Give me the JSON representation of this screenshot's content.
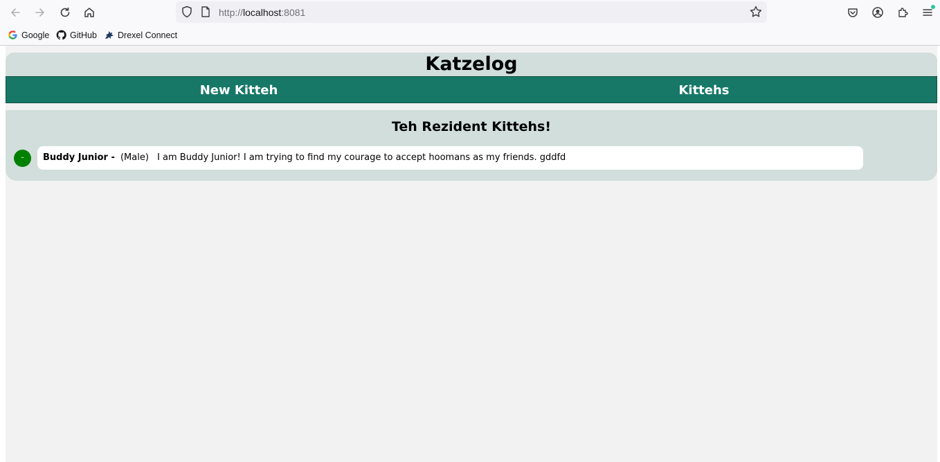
{
  "browser": {
    "url_prefix": "http://",
    "url_host": "localhost",
    "url_port": ":8081",
    "bookmarks": [
      {
        "label": "Google",
        "icon": "google-icon"
      },
      {
        "label": "GitHub",
        "icon": "github-icon"
      },
      {
        "label": "Drexel Connect",
        "icon": "dragon-icon"
      }
    ],
    "notification_dot_color": "#2ac3a2"
  },
  "page": {
    "title": "Katzelog",
    "nav": [
      {
        "label": "New Kitteh"
      },
      {
        "label": "Kittehs"
      }
    ],
    "section_title": "Teh Rezident Kittehs!",
    "kittehs": [
      {
        "remove_label": "–",
        "name": "Buddy Junior -",
        "gender": "(Male)",
        "description": "I am Buddy Junior! I am trying to find my courage to accept hoomans as my friends. gddfd"
      }
    ]
  },
  "colors": {
    "header_bg": "#d1dedb",
    "nav_bg": "#177867",
    "remove_button": "#008000",
    "page_bg": "#f2f2f2"
  }
}
